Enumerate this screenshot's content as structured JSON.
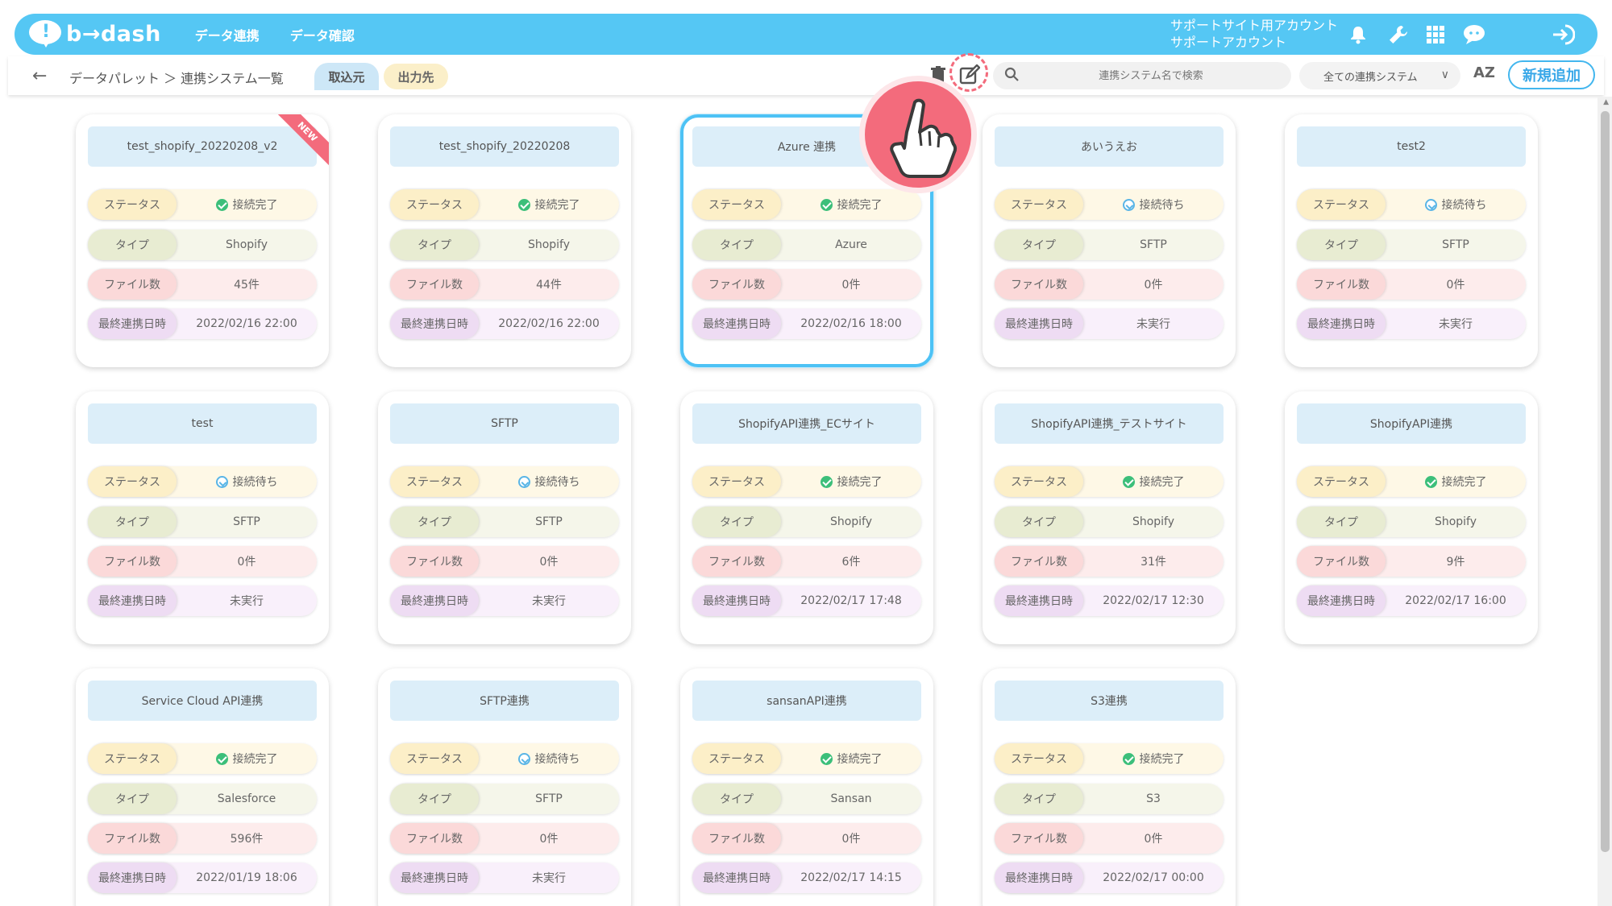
{
  "header": {
    "logo_text": "b→dash",
    "nav": [
      "データ連携",
      "データ確認"
    ],
    "account_line1": "サポートサイト用アカウント",
    "account_line2": "サポートアカウント",
    "icons": [
      "bell-icon",
      "wrench-icon",
      "grid-icon",
      "chat-icon",
      "logout-icon"
    ],
    "brand_color": "#55c7f4"
  },
  "toolbar": {
    "breadcrumb": "データパレット ＞ 連携システム一覧",
    "tab_in": "取込元",
    "tab_out": "出力先",
    "search_placeholder": "連携システム名で検索",
    "filter_selected": "全ての連携システム",
    "sort_label": "AZ",
    "add_button": "新規追加"
  },
  "labels": {
    "status": "ステータス",
    "type": "タイプ",
    "files": "ファイル数",
    "last_sync": "最終連携日時",
    "new_badge": "NEW"
  },
  "cards": [
    {
      "title": "test_shopify_20220208_v2",
      "status": "接続完了",
      "status_kind": "ok",
      "type": "Shopify",
      "files": "45件",
      "last_sync": "2022/02/16 22:00",
      "is_new": true
    },
    {
      "title": "test_shopify_20220208",
      "status": "接続完了",
      "status_kind": "ok",
      "type": "Shopify",
      "files": "44件",
      "last_sync": "2022/02/16 22:00"
    },
    {
      "title": "Azure 連携",
      "status": "接続完了",
      "status_kind": "ok",
      "type": "Azure",
      "files": "0件",
      "last_sync": "2022/02/16 18:00",
      "selected": true
    },
    {
      "title": "あいうえお",
      "status": "接続待ち",
      "status_kind": "wait",
      "type": "SFTP",
      "files": "0件",
      "last_sync": "未実行"
    },
    {
      "title": "test2",
      "status": "接続待ち",
      "status_kind": "wait",
      "type": "SFTP",
      "files": "0件",
      "last_sync": "未実行"
    },
    {
      "title": "test",
      "status": "接続待ち",
      "status_kind": "wait",
      "type": "SFTP",
      "files": "0件",
      "last_sync": "未実行"
    },
    {
      "title": "SFTP",
      "status": "接続待ち",
      "status_kind": "wait",
      "type": "SFTP",
      "files": "0件",
      "last_sync": "未実行"
    },
    {
      "title": "ShopifyAPI連携_ECサイト",
      "status": "接続完了",
      "status_kind": "ok",
      "type": "Shopify",
      "files": "6件",
      "last_sync": "2022/02/17 17:48"
    },
    {
      "title": "ShopifyAPI連携_テストサイト",
      "status": "接続完了",
      "status_kind": "ok",
      "type": "Shopify",
      "files": "31件",
      "last_sync": "2022/02/17 12:30"
    },
    {
      "title": "ShopifyAPI連携",
      "status": "接続完了",
      "status_kind": "ok",
      "type": "Shopify",
      "files": "9件",
      "last_sync": "2022/02/17 16:00"
    },
    {
      "title": "Service Cloud API連携",
      "status": "接続完了",
      "status_kind": "ok",
      "type": "Salesforce",
      "files": "596件",
      "last_sync": "2022/01/19 18:06"
    },
    {
      "title": "SFTP連携",
      "status": "接続待ち",
      "status_kind": "wait",
      "type": "SFTP",
      "files": "0件",
      "last_sync": "未実行"
    },
    {
      "title": "sansanAPI連携",
      "status": "接続完了",
      "status_kind": "ok",
      "type": "Sansan",
      "files": "0件",
      "last_sync": "2022/02/17 14:15"
    },
    {
      "title": "S3連携",
      "status": "接続完了",
      "status_kind": "ok",
      "type": "S3",
      "files": "0件",
      "last_sync": "2022/02/17 00:00"
    }
  ]
}
